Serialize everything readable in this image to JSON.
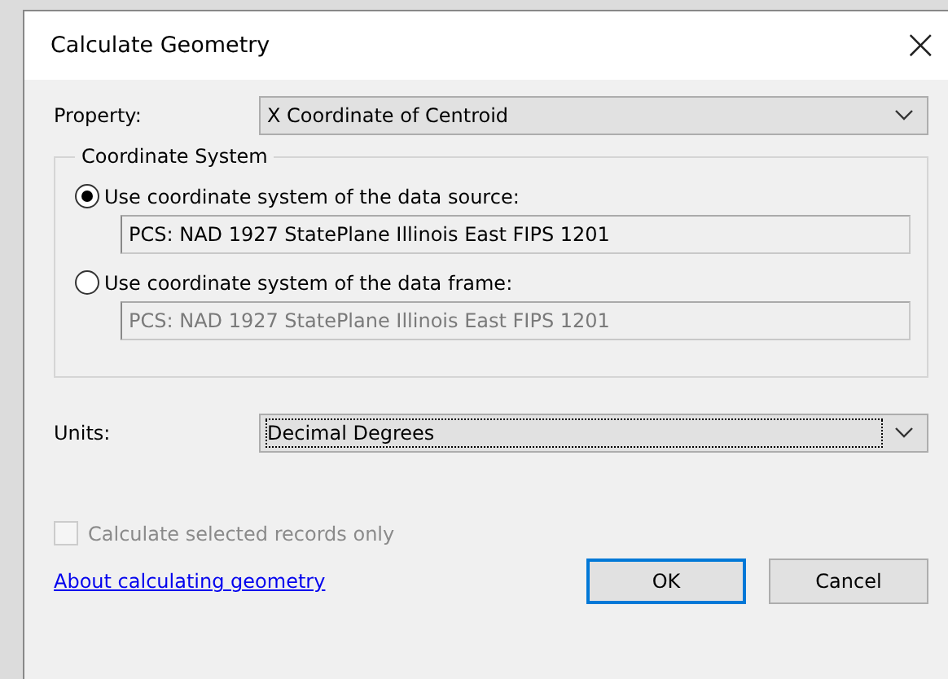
{
  "window": {
    "title": "Calculate Geometry",
    "close": "×"
  },
  "property": {
    "label": "Property:",
    "value": "X Coordinate of Centroid"
  },
  "coordinate_system": {
    "title": "Coordinate System",
    "options": [
      {
        "label": "Use coordinate system of the data source:",
        "selected": true,
        "value": "PCS: NAD 1927 StatePlane Illinois East FIPS 1201",
        "disabled": false
      },
      {
        "label": "Use coordinate system of the data frame:",
        "selected": false,
        "value": "PCS: NAD 1927 StatePlane Illinois East FIPS 1201",
        "disabled": true
      }
    ]
  },
  "units": {
    "label": "Units:",
    "value": "Decimal Degrees"
  },
  "selected_only": {
    "label": "Calculate selected records only",
    "checked": false,
    "disabled": true
  },
  "help_link": "About calculating geometry",
  "buttons": [
    {
      "label": "OK",
      "default": true
    },
    {
      "label": "Cancel",
      "default": false
    }
  ]
}
